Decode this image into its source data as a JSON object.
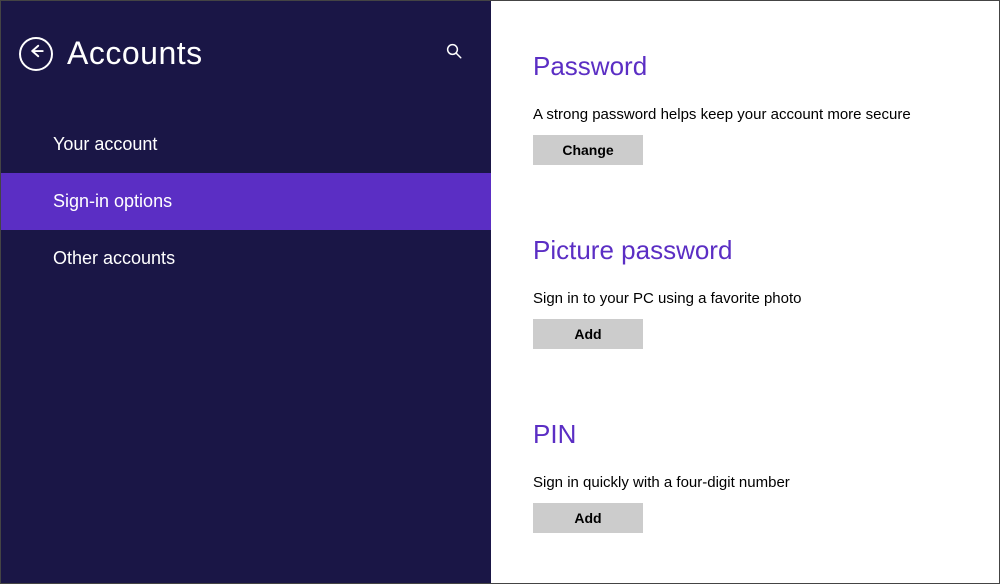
{
  "header": {
    "title": "Accounts"
  },
  "sidebar": {
    "items": [
      {
        "label": "Your account",
        "selected": false
      },
      {
        "label": "Sign-in options",
        "selected": true
      },
      {
        "label": "Other accounts",
        "selected": false
      }
    ]
  },
  "sections": {
    "password": {
      "title": "Password",
      "desc": "A strong password helps keep your account more secure",
      "button": "Change"
    },
    "picture": {
      "title": "Picture password",
      "desc": "Sign in to your PC using a favorite photo",
      "button": "Add"
    },
    "pin": {
      "title": "PIN",
      "desc": "Sign in quickly with a four-digit number",
      "button": "Add"
    }
  },
  "colors": {
    "sidebar_bg": "#1a1646",
    "accent": "#5b2ec4",
    "button_bg": "#cccccc"
  }
}
